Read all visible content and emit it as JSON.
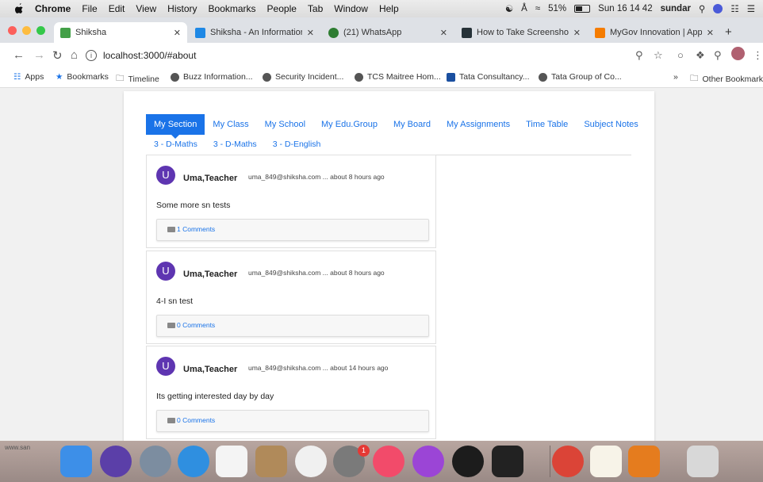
{
  "menubar": {
    "items": [
      "Chrome",
      "File",
      "Edit",
      "View",
      "History",
      "Bookmarks",
      "People",
      "Tab",
      "Window",
      "Help"
    ],
    "battery": "51%",
    "clock": "Sun 16 14 42",
    "user": "sundar"
  },
  "tabs": [
    {
      "label": "Shiksha",
      "icon_color": "#43a047"
    },
    {
      "label": "Shiksha - An Information Ma",
      "icon_color": "#1e88e5"
    },
    {
      "label": "(21) WhatsApp",
      "icon_color": "#2e7d32"
    },
    {
      "label": "How to Take Screenshots in",
      "icon_color": "#263238"
    },
    {
      "label": "MyGov Innovation | App Cha",
      "icon_color": "#f57c00"
    }
  ],
  "address": {
    "url": "localhost:3000/#about"
  },
  "bookmarks": {
    "apps": "Apps",
    "items": [
      "Bookmarks",
      "Timeline",
      "Buzz Information...",
      "Security Incident...",
      "TCS Maitree Hom...",
      "Tata Consultancy...",
      "Tata Group of Co..."
    ],
    "overflow": "»",
    "other": "Other Bookmarks"
  },
  "nav_tabs": [
    "My Section",
    "My Class",
    "My School",
    "My Edu.Group",
    "My Board",
    "My Assignments",
    "Time Table",
    "Subject Notes"
  ],
  "sub_tabs": [
    "3 - D-Maths",
    "3 - D-Maths",
    "3 - D-English"
  ],
  "posts": [
    {
      "avatar": "U",
      "author": "Uma,Teacher",
      "meta": "uma_849@shiksha.com ... about 8 hours ago",
      "body": "Some more sn tests",
      "comments": "1 Comments"
    },
    {
      "avatar": "U",
      "author": "Uma,Teacher",
      "meta": "uma_849@shiksha.com ... about 8 hours ago",
      "body": "4-I sn test",
      "comments": "0 Comments"
    },
    {
      "avatar": "U",
      "author": "Uma,Teacher",
      "meta": "uma_849@shiksha.com ... about 14 hours ago",
      "body": "Its getting interested day by day",
      "comments": "0 Comments"
    }
  ],
  "dock": {
    "side_text": "www.san",
    "badge": "1",
    "apps": [
      {
        "name": "finder-icon",
        "color": "#3d8fe8"
      },
      {
        "name": "siri-icon",
        "color": "#5b3fa8"
      },
      {
        "name": "launchpad-icon",
        "color": "#7c8da0"
      },
      {
        "name": "safari-icon",
        "color": "#2f8fe0"
      },
      {
        "name": "calculator-icon",
        "color": "#f4f4f4"
      },
      {
        "name": "contacts-icon",
        "color": "#b08a5a"
      },
      {
        "name": "photos-icon",
        "color": "#f0f0f0"
      },
      {
        "name": "system-preferences-icon",
        "color": "#7a7a7a"
      },
      {
        "name": "music-icon",
        "color": "#f24b6a"
      },
      {
        "name": "podcasts-icon",
        "color": "#9b45d6"
      },
      {
        "name": "apple-tv-icon",
        "color": "#1c1c1c"
      },
      {
        "name": "terminal-icon",
        "color": "#222222"
      },
      {
        "name": "chrome-icon",
        "color": "#db4437"
      },
      {
        "name": "textedit-icon",
        "color": "#f7f3e8"
      },
      {
        "name": "sublime-text-icon",
        "color": "#e57c1e"
      },
      {
        "name": "trash-icon",
        "color": "#d8d8d8"
      }
    ]
  }
}
